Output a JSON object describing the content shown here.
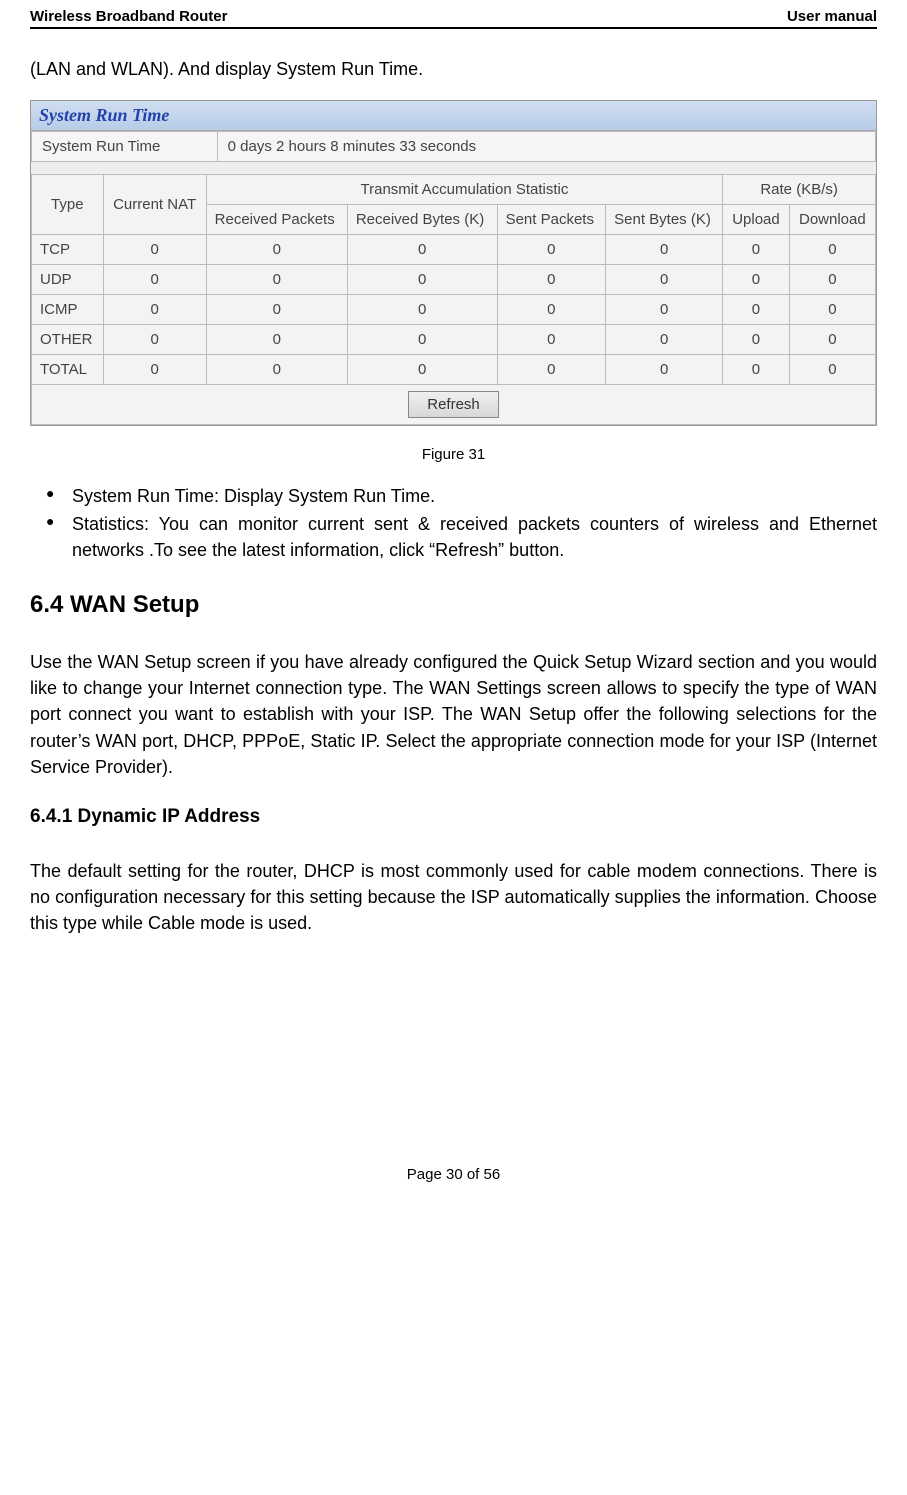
{
  "header": {
    "left": "Wireless Broadband Router",
    "right": "User manual"
  },
  "intro": "(LAN and WLAN). And display System Run Time.",
  "panel": {
    "title": "System Run Time",
    "runtime_label": "System Run Time",
    "runtime_value": "0 days  2 hours  8 minutes  33 seconds",
    "stats_headers": {
      "type": "Type",
      "current_nat": "Current NAT",
      "transmit_group": "Transmit Accumulation Statistic",
      "rate_group": "Rate (KB/s)",
      "recv_packets": "Received Packets",
      "recv_bytes": "Received Bytes (K)",
      "sent_packets": "Sent Packets",
      "sent_bytes": "Sent Bytes (K)",
      "upload": "Upload",
      "download": "Download"
    },
    "stats_rows": [
      {
        "type": "TCP",
        "nat": "0",
        "rp": "0",
        "rb": "0",
        "sp": "0",
        "sb": "0",
        "up": "0",
        "dn": "0"
      },
      {
        "type": "UDP",
        "nat": "0",
        "rp": "0",
        "rb": "0",
        "sp": "0",
        "sb": "0",
        "up": "0",
        "dn": "0"
      },
      {
        "type": "ICMP",
        "nat": "0",
        "rp": "0",
        "rb": "0",
        "sp": "0",
        "sb": "0",
        "up": "0",
        "dn": "0"
      },
      {
        "type": "OTHER",
        "nat": "0",
        "rp": "0",
        "rb": "0",
        "sp": "0",
        "sb": "0",
        "up": "0",
        "dn": "0"
      },
      {
        "type": "TOTAL",
        "nat": "0",
        "rp": "0",
        "rb": "0",
        "sp": "0",
        "sb": "0",
        "up": "0",
        "dn": "0"
      }
    ],
    "refresh_label": "Refresh"
  },
  "figure_caption": "Figure 31",
  "bullets": {
    "item1": "System Run Time: Display System Run Time.",
    "item2": "Statistics: You can monitor current sent & received packets counters of wireless and Ethernet networks .To see the latest information, click “Refresh” button."
  },
  "section_6_4": {
    "heading": "6.4 WAN Setup",
    "para": "Use the WAN Setup screen if you have already configured the Quick Setup Wizard section and you would like to change your Internet connection type. The WAN Settings screen allows to specify the type of WAN port connect you want to establish with your ISP. The WAN Setup offer the following selections for the router’s WAN port, DHCP, PPPoE, Static IP. Select the appropriate connection mode for your ISP (Internet Service Provider)."
  },
  "section_6_4_1": {
    "heading": "6.4.1 Dynamic IP Address",
    "para": "The default setting for the router, DHCP is most commonly used for cable modem connections. There is no configuration necessary for this setting because the ISP automatically supplies the information. Choose this type while Cable mode is used."
  },
  "footer": "Page 30 of 56"
}
